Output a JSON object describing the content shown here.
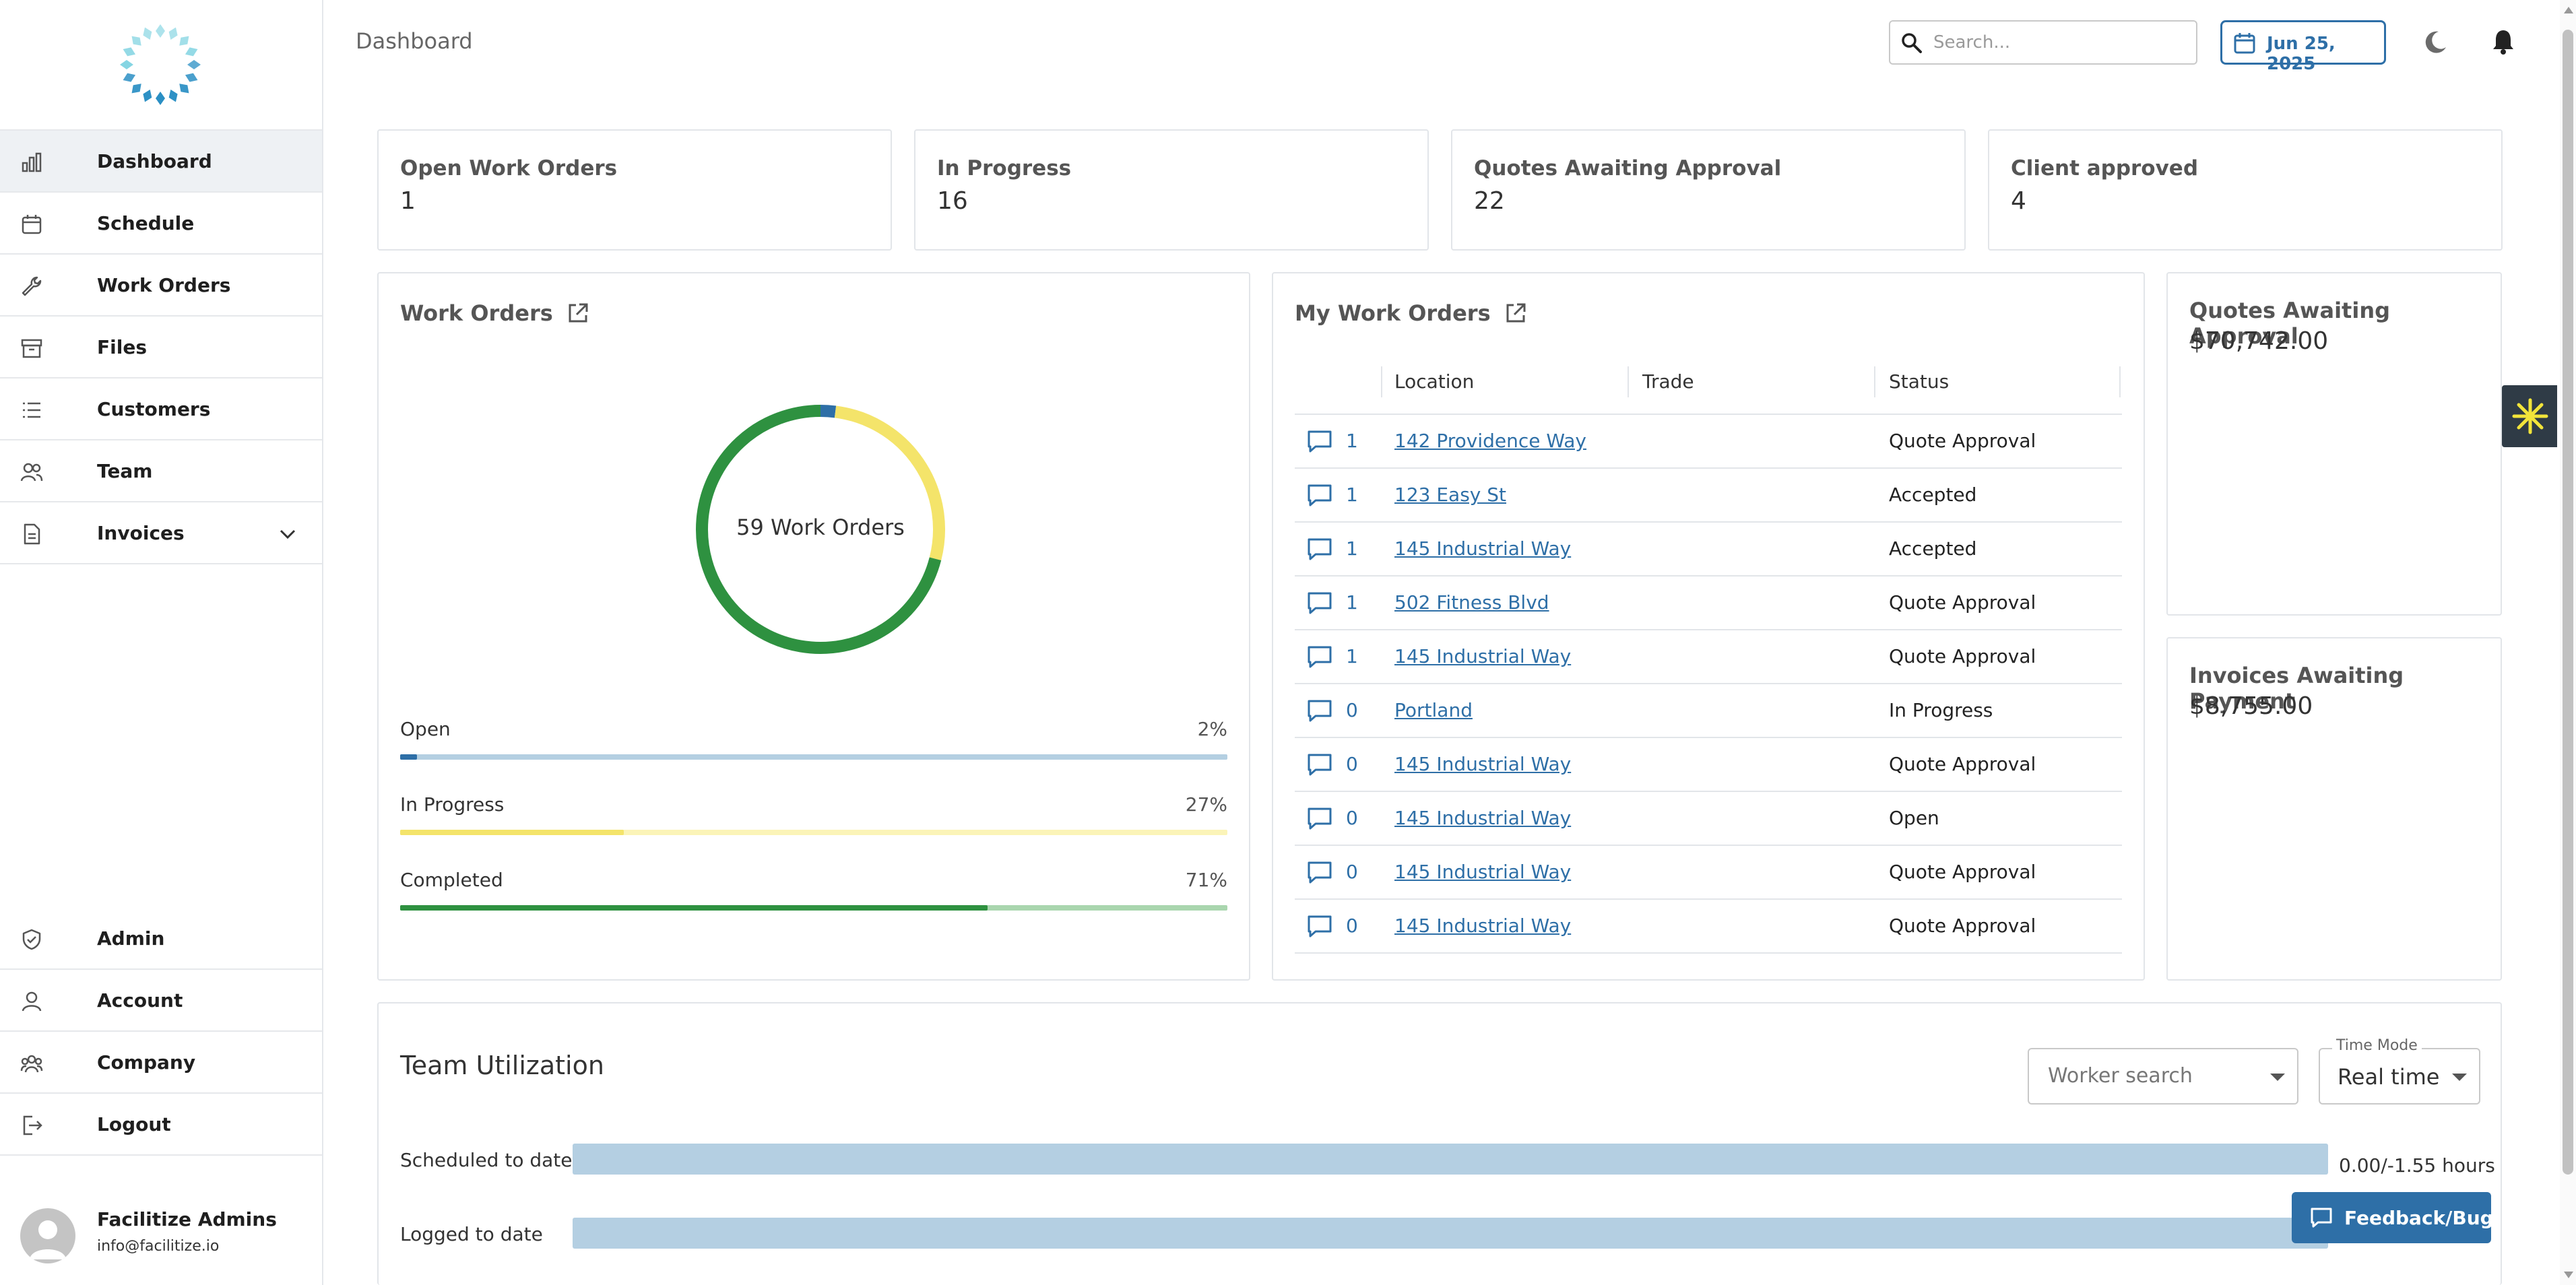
{
  "sidebar": {
    "logo_icon": "ring-logo-icon",
    "nav_top": [
      {
        "label": "Dashboard",
        "icon": "bar-chart-icon",
        "active": true
      },
      {
        "label": "Schedule",
        "icon": "calendar-icon"
      },
      {
        "label": "Work Orders",
        "icon": "wrench-icon"
      },
      {
        "label": "Files",
        "icon": "archive-icon"
      },
      {
        "label": "Customers",
        "icon": "list-icon"
      },
      {
        "label": "Team",
        "icon": "users-icon"
      },
      {
        "label": "Invoices",
        "icon": "document-icon",
        "expandable": true
      }
    ],
    "nav_bottom": [
      {
        "label": "Admin",
        "icon": "shield-icon"
      },
      {
        "label": "Account",
        "icon": "person-icon"
      },
      {
        "label": "Company",
        "icon": "people-group-icon"
      },
      {
        "label": "Logout",
        "icon": "logout-icon"
      }
    ],
    "user": {
      "name": "Facilitize Admins",
      "email": "info@facilitize.io"
    }
  },
  "header": {
    "title": "Dashboard",
    "search_placeholder": "Search...",
    "date": "Jun 25, 2025"
  },
  "stats": [
    {
      "label": "Open Work Orders",
      "value": "1"
    },
    {
      "label": "In Progress",
      "value": "16"
    },
    {
      "label": "Quotes Awaiting Approval",
      "value": "22"
    },
    {
      "label": "Client approved",
      "value": "4"
    }
  ],
  "work_orders_card": {
    "title": "Work Orders",
    "donut_label": "59 Work Orders",
    "breakdown": [
      {
        "name": "Open",
        "pct_label": "2%",
        "fraction": 0.02,
        "color": "#2e6fa7",
        "track": "#b4cfe2"
      },
      {
        "name": "In Progress",
        "pct_label": "27%",
        "fraction": 0.27,
        "color": "#f4e46a",
        "track": "#fbf4b8"
      },
      {
        "name": "Completed",
        "pct_label": "71%",
        "fraction": 0.71,
        "color": "#2e9140",
        "track": "#a9d6ae"
      }
    ]
  },
  "my_work_orders": {
    "title": "My Work Orders",
    "columns": [
      "Location",
      "Trade",
      "Status"
    ],
    "rows": [
      {
        "count": "1",
        "location": "142 Providence Way",
        "trade": "",
        "status": "Quote Approval"
      },
      {
        "count": "1",
        "location": "123 Easy St",
        "trade": "",
        "status": "Accepted"
      },
      {
        "count": "1",
        "location": "145 Industrial Way",
        "trade": "",
        "status": "Accepted"
      },
      {
        "count": "1",
        "location": "502 Fitness Blvd",
        "trade": "",
        "status": "Quote Approval"
      },
      {
        "count": "1",
        "location": "145 Industrial Way",
        "trade": "",
        "status": "Quote Approval"
      },
      {
        "count": "0",
        "location": "Portland",
        "trade": "",
        "status": "In Progress"
      },
      {
        "count": "0",
        "location": "145 Industrial Way",
        "trade": "",
        "status": "Quote Approval"
      },
      {
        "count": "0",
        "location": "145 Industrial Way",
        "trade": "",
        "status": "Open"
      },
      {
        "count": "0",
        "location": "145 Industrial Way",
        "trade": "",
        "status": "Quote Approval"
      },
      {
        "count": "0",
        "location": "145 Industrial Way",
        "trade": "",
        "status": "Quote Approval"
      }
    ]
  },
  "amounts": {
    "quotes_label": "Quotes Awaiting Approval",
    "quotes_value": "$70,742.00",
    "invoices_label": "Invoices Awaiting Payment",
    "invoices_value": "$8,755.00"
  },
  "team_utilization": {
    "title": "Team Utilization",
    "worker_search_placeholder": "Worker search",
    "time_mode_label": "Time Mode",
    "time_mode_value": "Real time",
    "scheduled_label": "Scheduled to date",
    "scheduled_value": "0.00/-1.55 hours",
    "logged_label": "Logged to date"
  },
  "feedback_label": "Feedback/Bug",
  "colors": {
    "accent": "#2e6fa7",
    "open": "#2e6fa7",
    "in_progress": "#f4e46a",
    "completed": "#2e9140"
  }
}
